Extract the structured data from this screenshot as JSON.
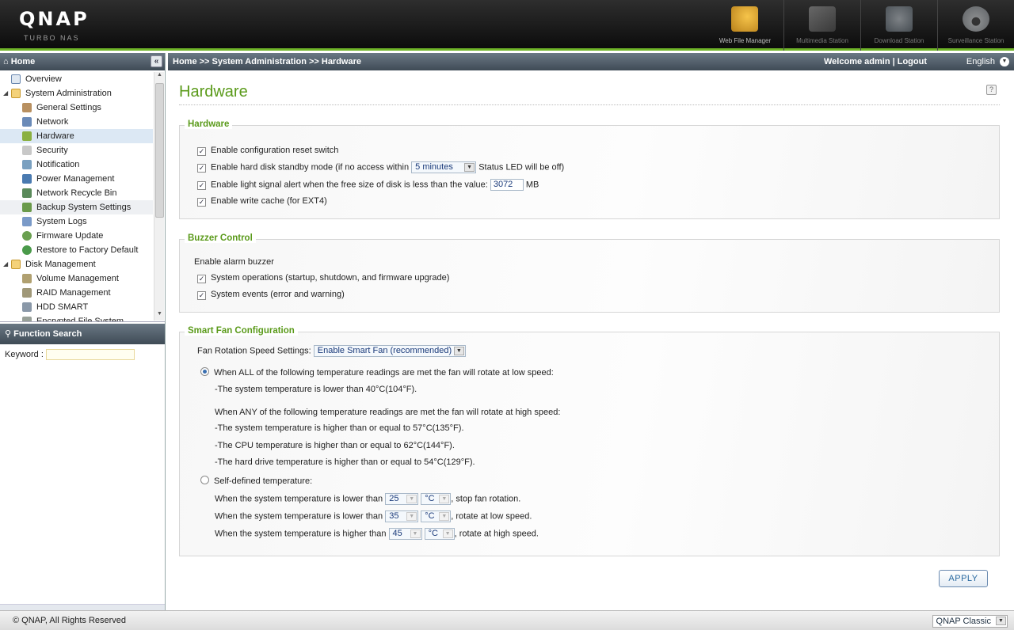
{
  "header": {
    "logo": "QNAP",
    "logo_sub": "TURBO NAS",
    "apps": [
      {
        "label": "Web File Manager",
        "icon": "folder-search-icon",
        "color": "#c8941c"
      },
      {
        "label": "Multimedia Station",
        "icon": "film-icon",
        "color": "#8a8a8a"
      },
      {
        "label": "Download Station",
        "icon": "download-globe-icon",
        "color": "#8a9aa8"
      },
      {
        "label": "Surveillance Station",
        "icon": "camera-dome-icon",
        "color": "#9aa0a6"
      }
    ]
  },
  "left_panel": {
    "title": "Home",
    "collapse": "«",
    "tree": [
      {
        "label": "Overview",
        "icon": "overview-icon"
      },
      {
        "label": "System Administration",
        "icon": "folder-open-icon"
      },
      {
        "label": "General Settings",
        "icon": "general-settings-icon"
      },
      {
        "label": "Network",
        "icon": "network-icon"
      },
      {
        "label": "Hardware",
        "icon": "hardware-icon"
      },
      {
        "label": "Security",
        "icon": "lock-icon"
      },
      {
        "label": "Notification",
        "icon": "notification-icon"
      },
      {
        "label": "Power Management",
        "icon": "power-icon"
      },
      {
        "label": "Network Recycle Bin",
        "icon": "recycle-bin-icon"
      },
      {
        "label": "Backup System Settings",
        "icon": "backup-icon"
      },
      {
        "label": "System Logs",
        "icon": "logs-icon"
      },
      {
        "label": "Firmware Update",
        "icon": "firmware-icon"
      },
      {
        "label": "Restore to Factory Default",
        "icon": "restore-icon"
      },
      {
        "label": "Disk Management",
        "icon": "folder-open-icon"
      },
      {
        "label": "Volume Management",
        "icon": "volume-icon"
      },
      {
        "label": "RAID Management",
        "icon": "raid-icon"
      },
      {
        "label": "HDD SMART",
        "icon": "hdd-smart-icon"
      },
      {
        "label": "Encrypted File System",
        "icon": "encrypted-fs-icon"
      }
    ],
    "function_search": {
      "title": "Function Search",
      "keyword_label": "Keyword :"
    }
  },
  "topnav": {
    "breadcrumb": "Home >> System Administration >> Hardware",
    "welcome": "Welcome admin | Logout",
    "language": "English"
  },
  "main": {
    "title": "Hardware",
    "help": "?",
    "hardware": {
      "legend": "Hardware",
      "reset_switch": "Enable configuration reset switch",
      "standby_pre": "Enable hard disk standby mode (if no access within",
      "standby_value": "5 minutes",
      "standby_post": "Status LED will be off)",
      "light_alert_pre": "Enable light signal alert when the free size of disk is less than the value:",
      "light_alert_value": "3072",
      "light_alert_unit": "MB",
      "write_cache": "Enable write cache (for EXT4)"
    },
    "buzzer": {
      "legend": "Buzzer Control",
      "enable_label": "Enable alarm buzzer",
      "system_operations": "System operations (startup, shutdown, and firmware upgrade)",
      "system_events": "System events (error and warning)"
    },
    "smart_fan": {
      "legend": "Smart Fan Configuration",
      "speed_label": "Fan Rotation Speed Settings:",
      "speed_value": "Enable Smart Fan (recommended)",
      "low_heading": "When ALL of the following temperature readings are met the fan will rotate at low speed:",
      "low_1": "-The system temperature is lower than 40°C(104°F).",
      "high_heading": "When ANY of the following temperature readings are met the fan will rotate at high speed:",
      "high_1": "-The system temperature is higher than or equal to 57°C(135°F).",
      "high_2": "-The CPU temperature is higher than or equal to 62°C(144°F).",
      "high_3": "-The hard drive temperature is higher than or equal to 54°C(129°F).",
      "self_defined": "Self-defined temperature:",
      "rows": [
        {
          "pre": "When the system temperature is lower than",
          "value": "25",
          "unit": "°C",
          "post": ", stop fan rotation."
        },
        {
          "pre": "When the system temperature is lower than",
          "value": "35",
          "unit": "°C",
          "post": ", rotate at low speed."
        },
        {
          "pre": "When the system temperature is higher than",
          "value": "45",
          "unit": "°C",
          "post": ", rotate at high speed."
        }
      ]
    },
    "apply": "APPLY"
  },
  "footer": {
    "copyright": "© QNAP, All Rights Reserved",
    "theme": "QNAP Classic"
  },
  "colors": {
    "accent_green": "#5a9a1a",
    "header_bar": "#3f4b56",
    "selected_row": "#dce8f4"
  }
}
